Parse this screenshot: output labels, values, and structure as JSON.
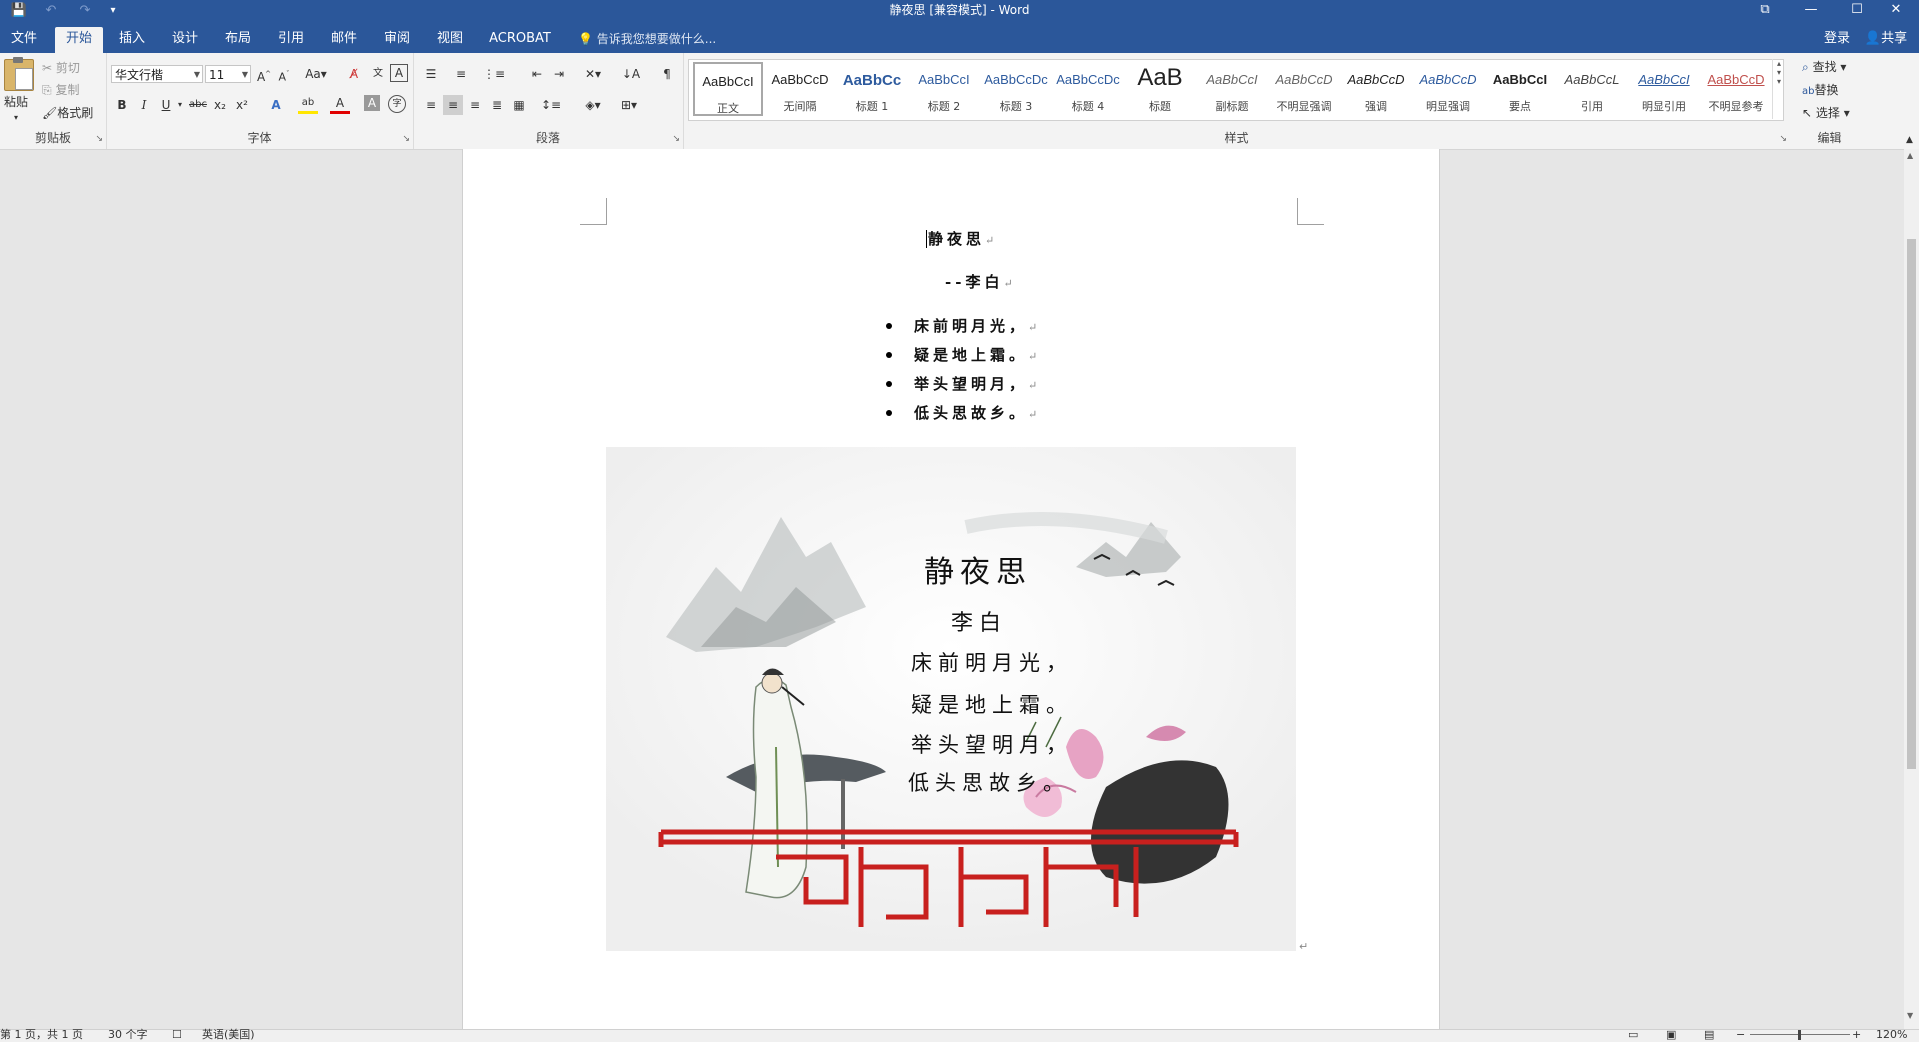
{
  "window": {
    "title": "静夜思 [兼容模式] - Word",
    "qat": {
      "save_icon": "💾",
      "undo_icon": "↶",
      "redo_icon": "↷",
      "customize_icon": "▾"
    },
    "controls": {
      "ribbon_display": "⧉",
      "minimize": "—",
      "maximize": "☐",
      "close": "✕"
    }
  },
  "tabs": [
    "文件",
    "开始",
    "插入",
    "设计",
    "布局",
    "引用",
    "邮件",
    "审阅",
    "视图",
    "ACROBAT"
  ],
  "active_tab": "开始",
  "tellme": "告诉我您想要做什么...",
  "account": {
    "login": "登录",
    "share": "共享"
  },
  "ribbon": {
    "clipboard": {
      "label": "剪贴板",
      "paste": "粘贴",
      "cut": "剪切",
      "copy": "复制",
      "format_painter": "格式刷"
    },
    "font": {
      "label": "字体",
      "font_name": "华文行楷",
      "font_size": "11",
      "grow": "A^",
      "shrink": "Aˇ",
      "case": "Aa",
      "clear": "A",
      "phonetic": "文",
      "charborder": "A",
      "bold": "B",
      "italic": "I",
      "underline": "U",
      "strike": "abc",
      "sub": "x₂",
      "sup": "x²",
      "effects": "A",
      "highlight": "ab",
      "fontcolor": "A",
      "shading": "A",
      "enclose": "字"
    },
    "paragraph": {
      "label": "段落"
    },
    "styles": {
      "label": "样式",
      "items": [
        {
          "preview": "AaBbCcI",
          "name": "正文",
          "color": "#222"
        },
        {
          "preview": "AaBbCcD",
          "name": "无间隔",
          "color": "#222"
        },
        {
          "preview": "AaBbCc",
          "name": "标题 1",
          "color": "#2e5b9e"
        },
        {
          "preview": "AaBbCcI",
          "name": "标题 2",
          "color": "#2e5b9e"
        },
        {
          "preview": "AaBbCcDc",
          "name": "标题 3",
          "color": "#2e5b9e"
        },
        {
          "preview": "AaBbCcDc",
          "name": "标题 4",
          "color": "#2e5b9e"
        },
        {
          "preview": "AaB",
          "name": "标题",
          "color": "#222"
        },
        {
          "preview": "AaBbCcI",
          "name": "副标题",
          "color": "#666"
        },
        {
          "preview": "AaBbCcD",
          "name": "不明显强调",
          "color": "#666"
        },
        {
          "preview": "AaBbCcD",
          "name": "强调",
          "color": "#222"
        },
        {
          "preview": "AaBbCcD",
          "name": "明显强调",
          "color": "#2e5b9e"
        },
        {
          "preview": "AaBbCcI",
          "name": "要点",
          "color": "#222"
        },
        {
          "preview": "AaBbCcL",
          "name": "引用",
          "color": "#444"
        },
        {
          "preview": "AaBbCcI",
          "name": "明显引用",
          "color": "#2e5b9e"
        },
        {
          "preview": "AaBbCcD",
          "name": "不明显参考",
          "color": "#c0504d"
        }
      ]
    },
    "editing": {
      "label": "编辑",
      "find": "查找",
      "replace": "替换",
      "select": "选择"
    }
  },
  "document": {
    "title": "静夜思",
    "author": "--李白",
    "lines": [
      "床前明月光，",
      "疑是地上霜。",
      "举头望明月，",
      "低头思故乡。"
    ],
    "paragraph_mark": "↵",
    "picture": {
      "title": "静夜思",
      "author": "李白",
      "lines": [
        "床前明月光，",
        "疑是地上霜。",
        "举头望明月，",
        "低头思故乡。"
      ]
    }
  },
  "statusbar": {
    "page": "第 1 页，共 1 页",
    "words": "30 个字",
    "language": "英语(美国)",
    "zoom": "120%"
  },
  "colors": {
    "accent": "#2b579a",
    "railing": "#c8201e"
  }
}
